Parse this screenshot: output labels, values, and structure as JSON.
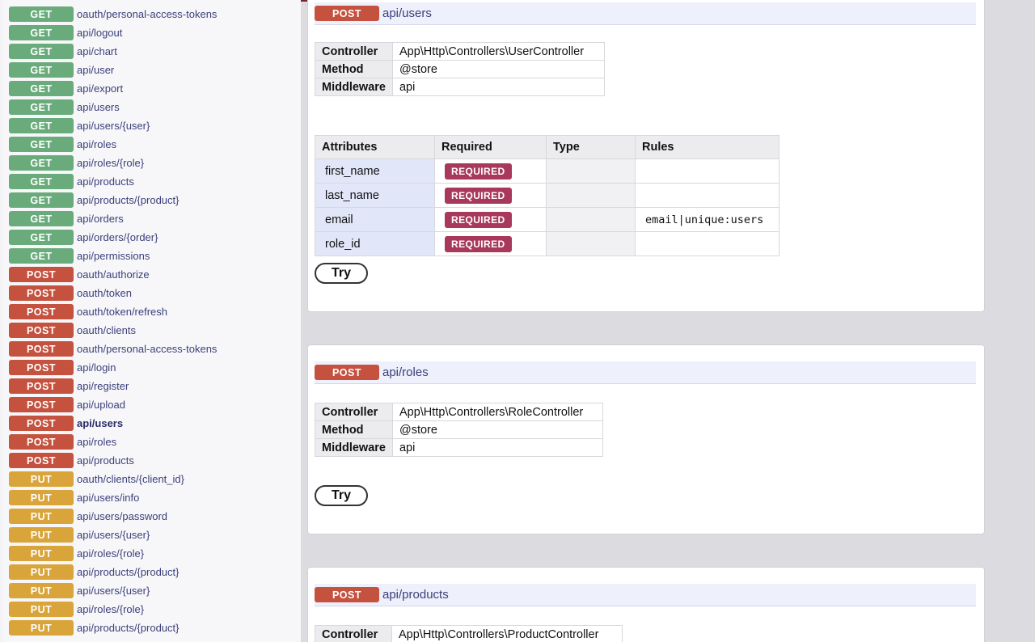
{
  "sidebar": {
    "items": [
      {
        "method": "GET",
        "path": "oauth/personal-access-tokens"
      },
      {
        "method": "GET",
        "path": "api/logout"
      },
      {
        "method": "GET",
        "path": "api/chart"
      },
      {
        "method": "GET",
        "path": "api/user"
      },
      {
        "method": "GET",
        "path": "api/export"
      },
      {
        "method": "GET",
        "path": "api/users"
      },
      {
        "method": "GET",
        "path": "api/users/{user}"
      },
      {
        "method": "GET",
        "path": "api/roles"
      },
      {
        "method": "GET",
        "path": "api/roles/{role}"
      },
      {
        "method": "GET",
        "path": "api/products"
      },
      {
        "method": "GET",
        "path": "api/products/{product}"
      },
      {
        "method": "GET",
        "path": "api/orders"
      },
      {
        "method": "GET",
        "path": "api/orders/{order}"
      },
      {
        "method": "GET",
        "path": "api/permissions"
      },
      {
        "method": "POST",
        "path": "oauth/authorize"
      },
      {
        "method": "POST",
        "path": "oauth/token"
      },
      {
        "method": "POST",
        "path": "oauth/token/refresh"
      },
      {
        "method": "POST",
        "path": "oauth/clients"
      },
      {
        "method": "POST",
        "path": "oauth/personal-access-tokens"
      },
      {
        "method": "POST",
        "path": "api/login"
      },
      {
        "method": "POST",
        "path": "api/register"
      },
      {
        "method": "POST",
        "path": "api/upload"
      },
      {
        "method": "POST",
        "path": "api/users",
        "active": true
      },
      {
        "method": "POST",
        "path": "api/roles"
      },
      {
        "method": "POST",
        "path": "api/products"
      },
      {
        "method": "PUT",
        "path": "oauth/clients/{client_id}"
      },
      {
        "method": "PUT",
        "path": "api/users/info"
      },
      {
        "method": "PUT",
        "path": "api/users/password"
      },
      {
        "method": "PUT",
        "path": "api/users/{user}"
      },
      {
        "method": "PUT",
        "path": "api/roles/{role}"
      },
      {
        "method": "PUT",
        "path": "api/products/{product}"
      },
      {
        "method": "PUT",
        "path": "api/users/{user}"
      },
      {
        "method": "PUT",
        "path": "api/roles/{role}"
      },
      {
        "method": "PUT",
        "path": "api/products/{product}"
      }
    ]
  },
  "colors": {
    "get": "#6aab7b",
    "post": "#c5523f",
    "put": "#d9a43a",
    "required": "#a8395d",
    "link": "#3b3f7a"
  },
  "endpoints": [
    {
      "method": "POST",
      "path": "api/users",
      "info": {
        "controller_label": "Controller",
        "controller": "App\\Http\\Controllers\\UserController",
        "method_label": "Method",
        "method": "@store",
        "middleware_label": "Middleware",
        "middleware": "api"
      },
      "attributes": {
        "headers": [
          "Attributes",
          "Required",
          "Type",
          "Rules"
        ],
        "rows": [
          {
            "name": "first_name",
            "required": "REQUIRED",
            "type": "",
            "rules": ""
          },
          {
            "name": "last_name",
            "required": "REQUIRED",
            "type": "",
            "rules": ""
          },
          {
            "name": "email",
            "required": "REQUIRED",
            "type": "",
            "rules": "email|unique:users"
          },
          {
            "name": "role_id",
            "required": "REQUIRED",
            "type": "",
            "rules": ""
          }
        ]
      },
      "try_label": "Try"
    },
    {
      "method": "POST",
      "path": "api/roles",
      "info": {
        "controller_label": "Controller",
        "controller": "App\\Http\\Controllers\\RoleController",
        "method_label": "Method",
        "method": "@store",
        "middleware_label": "Middleware",
        "middleware": "api"
      },
      "try_label": "Try"
    },
    {
      "method": "POST",
      "path": "api/products",
      "info": {
        "controller_label": "Controller",
        "controller": "App\\Http\\Controllers\\ProductController"
      }
    }
  ]
}
